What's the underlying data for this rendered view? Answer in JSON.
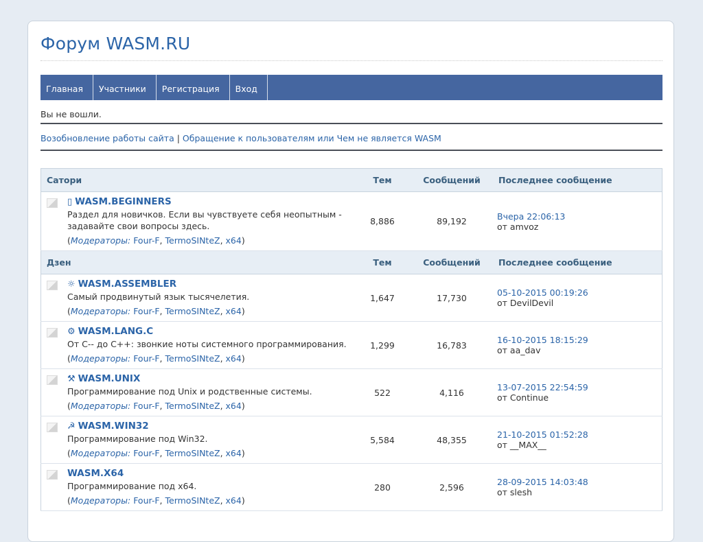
{
  "site": {
    "title": "Форум WASM.RU",
    "nav": [
      "Главная",
      "Участники",
      "Регистрация",
      "Вход"
    ],
    "status": "Вы не вошли.",
    "announcement": {
      "link1": "Возобновление работы сайта",
      "separator": "|",
      "link2": "Обращение к пользователям или Чем не является WASM"
    }
  },
  "columns": {
    "topics": "Тем",
    "posts": "Сообщений",
    "last_post": "Последнее сообщение"
  },
  "categories": [
    {
      "name": "Сатори",
      "forums": [
        {
          "icon": "▯",
          "icon_name": "rectangle-icon",
          "name": "WASM.BEGINNERS",
          "desc": "Раздел для новичков. Если вы чувствуете себя неопытным - задавайте свои вопросы здесь.",
          "topics": "8,886",
          "posts": "89,192",
          "last_date": "Вчера 22:06:13",
          "last_by": "от amvoz"
        }
      ]
    },
    {
      "name": "Дзен",
      "forums": [
        {
          "icon": "☼",
          "icon_name": "sun-icon",
          "name": "WASM.ASSEMBLER",
          "desc": "Самый продвинутый язык тысячелетия.",
          "topics": "1,647",
          "posts": "17,730",
          "last_date": "05-10-2015 00:19:26",
          "last_by": "от DevilDevil"
        },
        {
          "icon": "⚙",
          "icon_name": "gear-icon",
          "name": "WASM.LANG.C",
          "desc": "От С-- до С++: звонкие ноты системного программирования.",
          "topics": "1,299",
          "posts": "16,783",
          "last_date": "16-10-2015 18:15:29",
          "last_by": "от aa_dav"
        },
        {
          "icon": "⚒",
          "icon_name": "hammer-pick-icon",
          "name": "WASM.UNIX",
          "desc": "Программирование под Unix и родственные системы.",
          "topics": "522",
          "posts": "4,116",
          "last_date": "13-07-2015 22:54:59",
          "last_by": "от Continue"
        },
        {
          "icon": "☭",
          "icon_name": "hammer-sickle-icon",
          "name": "WASM.WIN32",
          "desc": "Программирование под Win32.",
          "topics": "5,584",
          "posts": "48,355",
          "last_date": "21-10-2015 01:52:28",
          "last_by": "от __MAX__"
        },
        {
          "icon": "",
          "icon_name": "",
          "name": "WASM.X64",
          "desc": "Программирование под x64.",
          "topics": "280",
          "posts": "2,596",
          "last_date": "28-09-2015 14:03:48",
          "last_by": "от slesh"
        }
      ]
    }
  ],
  "moderators": {
    "label": "Модераторы:",
    "names": [
      "Four-F",
      "TermoSINteZ",
      "x64"
    ]
  }
}
